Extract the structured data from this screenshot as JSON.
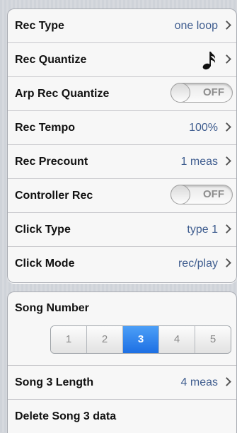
{
  "settings": {
    "rows": [
      {
        "label": "Rec Type",
        "value": "one loop"
      },
      {
        "label": "Rec Quantize",
        "value": ""
      },
      {
        "label": "Arp Rec Quantize",
        "toggle": "OFF"
      },
      {
        "label": "Rec Tempo",
        "value": "100%"
      },
      {
        "label": "Rec Precount",
        "value": "1 meas"
      },
      {
        "label": "Controller Rec",
        "toggle": "OFF"
      },
      {
        "label": "Click Type",
        "value": "type 1"
      },
      {
        "label": "Click Mode",
        "value": "rec/play"
      }
    ],
    "rec_quantize_icon": "sixteenth-note-icon"
  },
  "song": {
    "number_label": "Song Number",
    "segments": [
      "1",
      "2",
      "3",
      "4",
      "5"
    ],
    "selected": "3",
    "length_label": "Song 3 Length",
    "length_value": "4 meas",
    "delete_label": "Delete Song 3 data"
  },
  "colors": {
    "value_text": "#3f5d8f",
    "selected_segment": "#1d6fe3"
  }
}
